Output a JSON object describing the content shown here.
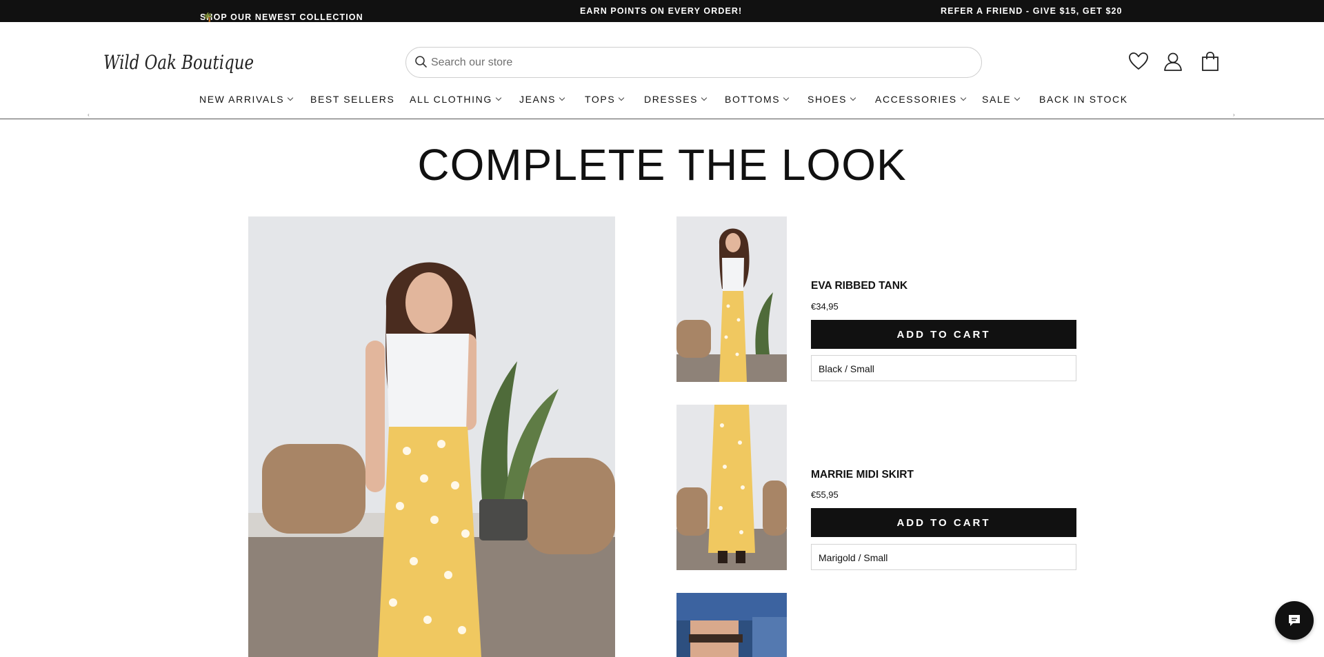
{
  "announcements": [
    {
      "text": "SHOP OUR NEWEST COLLECTION",
      "emoji": "🌴"
    },
    {
      "text": "EARN POINTS ON EVERY ORDER!"
    },
    {
      "text": "REFER A FRIEND - GIVE $15, GET $20"
    }
  ],
  "header": {
    "logo_text": "Wild Oak Boutique",
    "search_placeholder": "Search our store",
    "icons": [
      "heart-icon",
      "account-icon",
      "shopping-bag-icon"
    ]
  },
  "nav": {
    "items": [
      {
        "label": "NEW ARRIVALS",
        "has_dropdown": true
      },
      {
        "label": "BEST SELLERS",
        "has_dropdown": false
      },
      {
        "label": "ALL CLOTHING",
        "has_dropdown": true
      },
      {
        "label": "JEANS",
        "has_dropdown": true
      },
      {
        "label": "TOPS",
        "has_dropdown": true
      },
      {
        "label": "DRESSES",
        "has_dropdown": true
      },
      {
        "label": "BOTTOMS",
        "has_dropdown": true
      },
      {
        "label": "SHOES",
        "has_dropdown": true
      },
      {
        "label": "ACCESSORIES",
        "has_dropdown": true
      },
      {
        "label": "SALE",
        "has_dropdown": true
      },
      {
        "label": "BACK IN STOCK",
        "has_dropdown": false
      }
    ],
    "prev_arrow": "‹",
    "next_arrow": "›"
  },
  "main": {
    "title": "COMPLETE THE LOOK",
    "products": [
      {
        "name": "EVA RIBBED TANK",
        "price": "€34,95",
        "button": "ADD TO CART",
        "variant": "Black / Small"
      },
      {
        "name": "MARRIE MIDI SKIRT",
        "price": "€55,95",
        "button": "ADD TO CART",
        "variant": "Marigold / Small"
      }
    ]
  },
  "colors": {
    "bar": "#111111",
    "accent_yellow": "#f0c860",
    "white": "#ffffff"
  },
  "chat": {
    "icon": "chat-bubble-icon"
  }
}
